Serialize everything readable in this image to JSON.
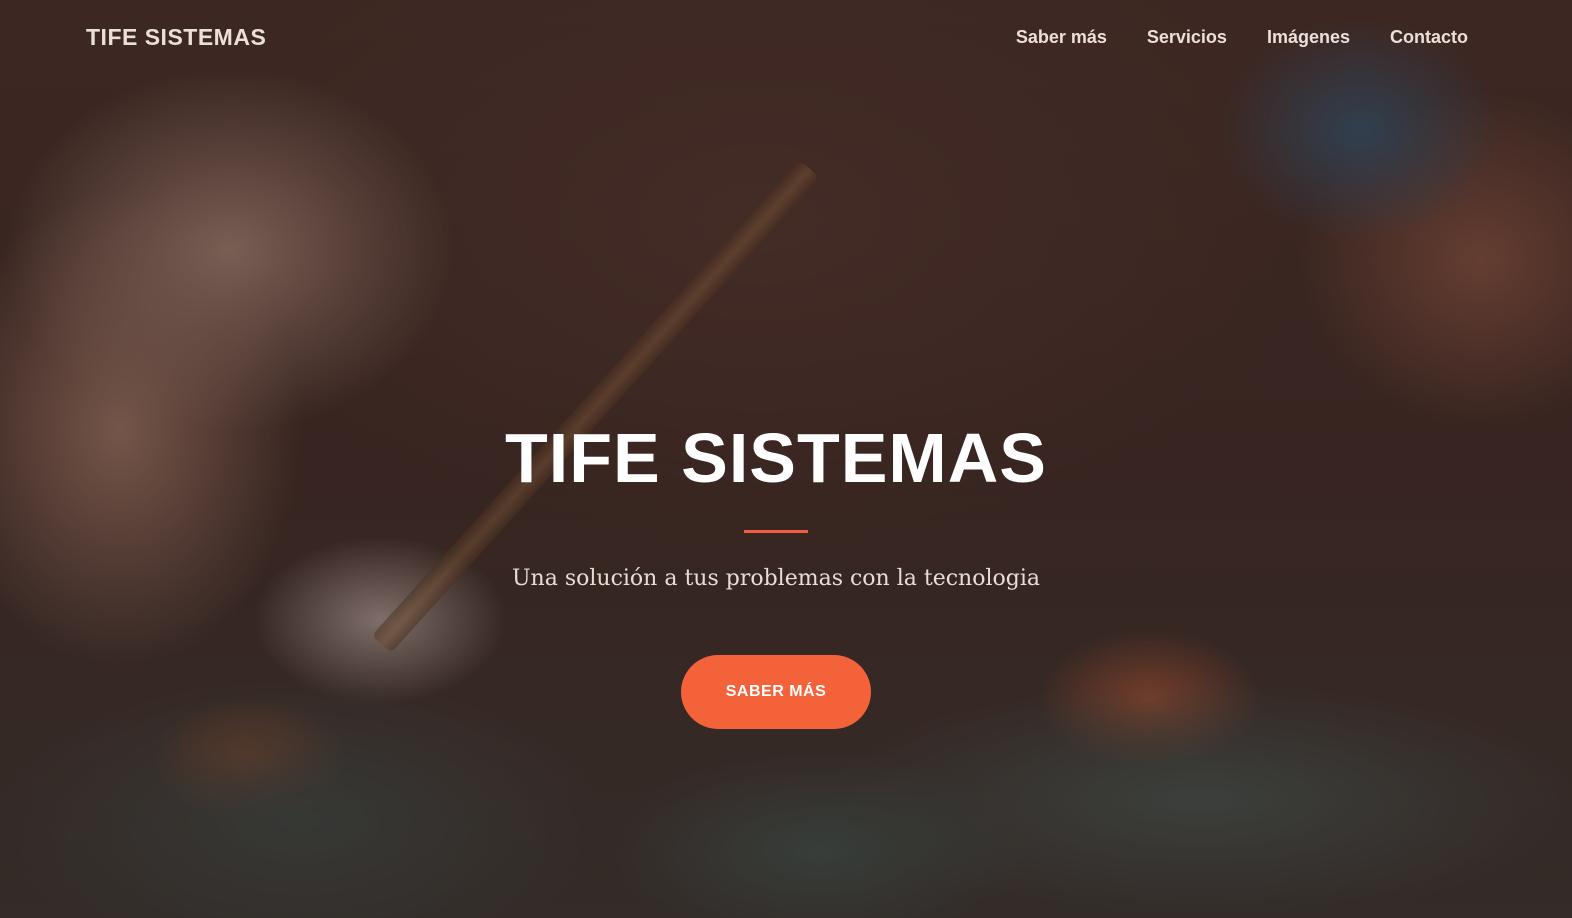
{
  "navbar": {
    "brand": "TIFE SISTEMAS",
    "links": [
      {
        "label": "Saber más"
      },
      {
        "label": "Servicios"
      },
      {
        "label": "Imágenes"
      },
      {
        "label": "Contacto"
      }
    ]
  },
  "hero": {
    "title": "TIFE SISTEMAS",
    "subtitle": "Una solución a tus problemas con la tecnologia",
    "cta_label": "SABER MÁS"
  },
  "colors": {
    "accent": "#f4623a",
    "divider": "#f05f40",
    "overlay": "#341e1a"
  }
}
